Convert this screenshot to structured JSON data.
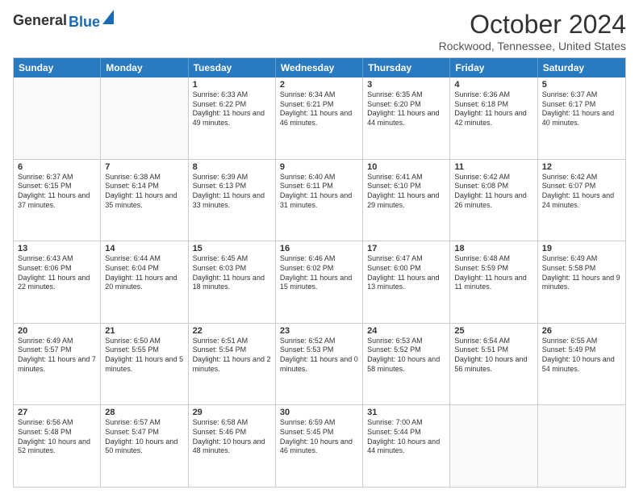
{
  "header": {
    "logo_general": "General",
    "logo_blue": "Blue",
    "month_title": "October 2024",
    "subtitle": "Rockwood, Tennessee, United States"
  },
  "weekdays": [
    "Sunday",
    "Monday",
    "Tuesday",
    "Wednesday",
    "Thursday",
    "Friday",
    "Saturday"
  ],
  "rows": [
    [
      {
        "day": "",
        "text": ""
      },
      {
        "day": "",
        "text": ""
      },
      {
        "day": "1",
        "text": "Sunrise: 6:33 AM\nSunset: 6:22 PM\nDaylight: 11 hours and 49 minutes."
      },
      {
        "day": "2",
        "text": "Sunrise: 6:34 AM\nSunset: 6:21 PM\nDaylight: 11 hours and 46 minutes."
      },
      {
        "day": "3",
        "text": "Sunrise: 6:35 AM\nSunset: 6:20 PM\nDaylight: 11 hours and 44 minutes."
      },
      {
        "day": "4",
        "text": "Sunrise: 6:36 AM\nSunset: 6:18 PM\nDaylight: 11 hours and 42 minutes."
      },
      {
        "day": "5",
        "text": "Sunrise: 6:37 AM\nSunset: 6:17 PM\nDaylight: 11 hours and 40 minutes."
      }
    ],
    [
      {
        "day": "6",
        "text": "Sunrise: 6:37 AM\nSunset: 6:15 PM\nDaylight: 11 hours and 37 minutes."
      },
      {
        "day": "7",
        "text": "Sunrise: 6:38 AM\nSunset: 6:14 PM\nDaylight: 11 hours and 35 minutes."
      },
      {
        "day": "8",
        "text": "Sunrise: 6:39 AM\nSunset: 6:13 PM\nDaylight: 11 hours and 33 minutes."
      },
      {
        "day": "9",
        "text": "Sunrise: 6:40 AM\nSunset: 6:11 PM\nDaylight: 11 hours and 31 minutes."
      },
      {
        "day": "10",
        "text": "Sunrise: 6:41 AM\nSunset: 6:10 PM\nDaylight: 11 hours and 29 minutes."
      },
      {
        "day": "11",
        "text": "Sunrise: 6:42 AM\nSunset: 6:08 PM\nDaylight: 11 hours and 26 minutes."
      },
      {
        "day": "12",
        "text": "Sunrise: 6:42 AM\nSunset: 6:07 PM\nDaylight: 11 hours and 24 minutes."
      }
    ],
    [
      {
        "day": "13",
        "text": "Sunrise: 6:43 AM\nSunset: 6:06 PM\nDaylight: 11 hours and 22 minutes."
      },
      {
        "day": "14",
        "text": "Sunrise: 6:44 AM\nSunset: 6:04 PM\nDaylight: 11 hours and 20 minutes."
      },
      {
        "day": "15",
        "text": "Sunrise: 6:45 AM\nSunset: 6:03 PM\nDaylight: 11 hours and 18 minutes."
      },
      {
        "day": "16",
        "text": "Sunrise: 6:46 AM\nSunset: 6:02 PM\nDaylight: 11 hours and 15 minutes."
      },
      {
        "day": "17",
        "text": "Sunrise: 6:47 AM\nSunset: 6:00 PM\nDaylight: 11 hours and 13 minutes."
      },
      {
        "day": "18",
        "text": "Sunrise: 6:48 AM\nSunset: 5:59 PM\nDaylight: 11 hours and 11 minutes."
      },
      {
        "day": "19",
        "text": "Sunrise: 6:49 AM\nSunset: 5:58 PM\nDaylight: 11 hours and 9 minutes."
      }
    ],
    [
      {
        "day": "20",
        "text": "Sunrise: 6:49 AM\nSunset: 5:57 PM\nDaylight: 11 hours and 7 minutes."
      },
      {
        "day": "21",
        "text": "Sunrise: 6:50 AM\nSunset: 5:55 PM\nDaylight: 11 hours and 5 minutes."
      },
      {
        "day": "22",
        "text": "Sunrise: 6:51 AM\nSunset: 5:54 PM\nDaylight: 11 hours and 2 minutes."
      },
      {
        "day": "23",
        "text": "Sunrise: 6:52 AM\nSunset: 5:53 PM\nDaylight: 11 hours and 0 minutes."
      },
      {
        "day": "24",
        "text": "Sunrise: 6:53 AM\nSunset: 5:52 PM\nDaylight: 10 hours and 58 minutes."
      },
      {
        "day": "25",
        "text": "Sunrise: 6:54 AM\nSunset: 5:51 PM\nDaylight: 10 hours and 56 minutes."
      },
      {
        "day": "26",
        "text": "Sunrise: 6:55 AM\nSunset: 5:49 PM\nDaylight: 10 hours and 54 minutes."
      }
    ],
    [
      {
        "day": "27",
        "text": "Sunrise: 6:56 AM\nSunset: 5:48 PM\nDaylight: 10 hours and 52 minutes."
      },
      {
        "day": "28",
        "text": "Sunrise: 6:57 AM\nSunset: 5:47 PM\nDaylight: 10 hours and 50 minutes."
      },
      {
        "day": "29",
        "text": "Sunrise: 6:58 AM\nSunset: 5:46 PM\nDaylight: 10 hours and 48 minutes."
      },
      {
        "day": "30",
        "text": "Sunrise: 6:59 AM\nSunset: 5:45 PM\nDaylight: 10 hours and 46 minutes."
      },
      {
        "day": "31",
        "text": "Sunrise: 7:00 AM\nSunset: 5:44 PM\nDaylight: 10 hours and 44 minutes."
      },
      {
        "day": "",
        "text": ""
      },
      {
        "day": "",
        "text": ""
      }
    ]
  ]
}
